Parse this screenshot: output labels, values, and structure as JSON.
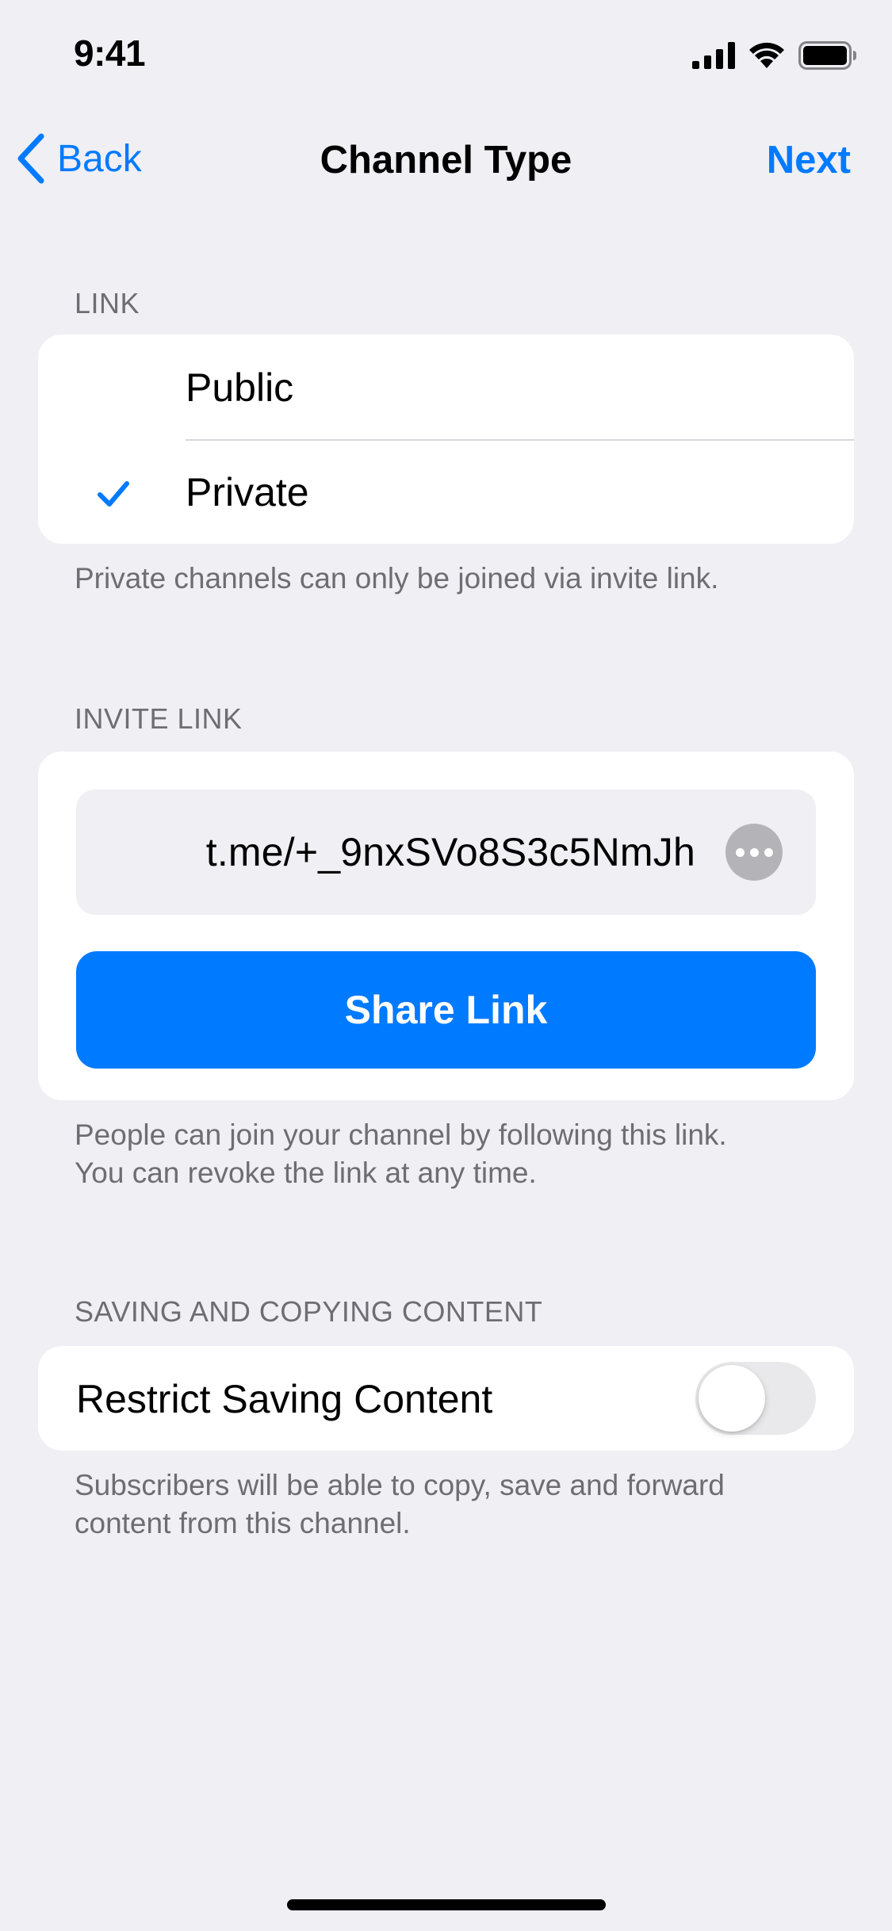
{
  "status_bar": {
    "time": "9:41"
  },
  "nav": {
    "back_label": "Back",
    "title": "Channel Type",
    "next_label": "Next"
  },
  "link_section": {
    "header": "LINK",
    "options": [
      {
        "label": "Public",
        "selected": false
      },
      {
        "label": "Private",
        "selected": true
      }
    ],
    "footer": "Private channels can only be joined via invite link."
  },
  "invite_section": {
    "header": "INVITE LINK",
    "link_value": "t.me/+_9nxSVo8S3c5NmJh",
    "share_label": "Share Link",
    "footer_line1": "People can join your channel by following this link.",
    "footer_line2": "You can revoke the link at any time."
  },
  "content_section": {
    "header": "SAVING AND COPYING CONTENT",
    "toggle_label": "Restrict Saving Content",
    "toggle_on": false,
    "footer_line1": "Subscribers will be able to copy, save and forward",
    "footer_line2": "content from this channel."
  },
  "colors": {
    "accent": "#007aff",
    "background": "#efeff4",
    "secondary_text": "#6d6d72"
  },
  "icons": {
    "back": "chevron-left-icon",
    "check": "checkmark-icon",
    "more": "ellipsis-icon",
    "signal": "cellular-signal-icon",
    "wifi": "wifi-icon",
    "battery": "battery-icon"
  }
}
